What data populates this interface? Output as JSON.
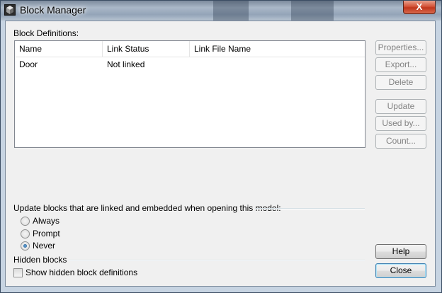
{
  "window": {
    "title": "Block Manager",
    "close_glyph": "X"
  },
  "definitions": {
    "label": "Block Definitions:",
    "columns": [
      "Name",
      "Link Status",
      "Link File Name"
    ],
    "rows": [
      {
        "name": "Door",
        "link_status": "Not linked",
        "link_file": ""
      }
    ]
  },
  "side_buttons": {
    "properties": "Properties...",
    "export": "Export...",
    "delete": "Delete",
    "update": "Update",
    "used_by": "Used by...",
    "count": "Count..."
  },
  "update_group": {
    "label": "Update blocks that are linked and embedded when opening this model:",
    "options": [
      "Always",
      "Prompt",
      "Never"
    ],
    "selected": "Never"
  },
  "hidden_group": {
    "label": "Hidden blocks",
    "checkbox_label": "Show hidden block definitions",
    "checked": false
  },
  "bottom_buttons": {
    "help": "Help",
    "close": "Close"
  },
  "colors": {
    "accent": "#3c7fb1",
    "close_button": "#c7432a"
  },
  "icons": [
    "block-manager-app-icon",
    "close-icon"
  ]
}
